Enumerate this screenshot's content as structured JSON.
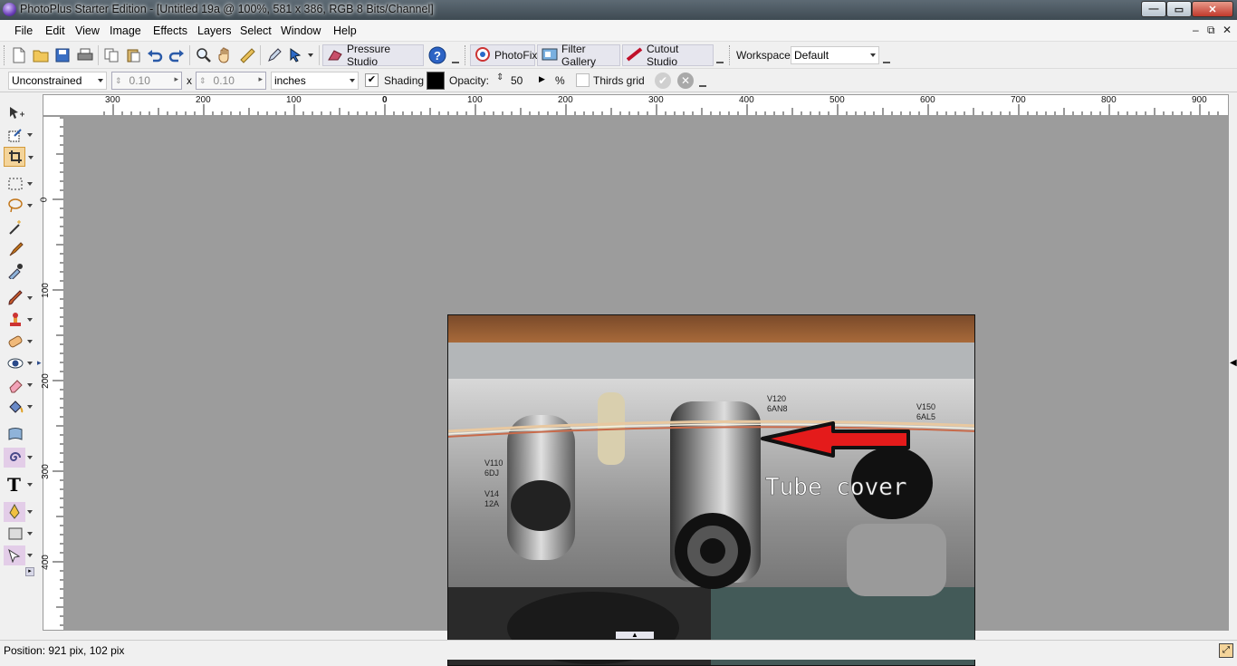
{
  "window": {
    "title": "PhotoPlus Starter Edition - [Untitled 19a @ 100%, 581 x 386, RGB 8 Bits/Channel]",
    "minimize": "—",
    "maximize": "▭",
    "close": "✕"
  },
  "menu": [
    "File",
    "Edit",
    "View",
    "Image",
    "Effects",
    "Layers",
    "Select",
    "Window",
    "Help"
  ],
  "mdi_controls": [
    "–",
    "⧉",
    "✕"
  ],
  "toolbar": {
    "pressure_studio": "Pressure Studio",
    "photofix": "PhotoFix",
    "filter_gallery": "Filter Gallery",
    "cutout_studio": "Cutout Studio",
    "workspace_label": "Workspace",
    "workspace_value": "Default"
  },
  "context_bar": {
    "mode": "Unconstrained",
    "width": "0.10",
    "x_label": "x",
    "height": "0.10",
    "units": "inches",
    "shading_label": "Shading",
    "shading_checked": true,
    "shading_color": "#000000",
    "opacity_label": "Opacity:",
    "opacity_value": "50",
    "opacity_unit": "%",
    "thirds_grid_label": "Thirds grid",
    "thirds_grid_checked": false
  },
  "ruler": {
    "top_labels": [
      "300",
      "200",
      "100",
      "0",
      "100",
      "200",
      "300",
      "400",
      "500",
      "600",
      "700",
      "800",
      "900"
    ],
    "left_labels": [
      "0",
      "100",
      "200",
      "300",
      "400"
    ]
  },
  "image": {
    "annotation_text": "Tube cover",
    "label_v120": "V120",
    "label_6an8": "6AN8",
    "label_v150": "V150",
    "label_6al5": "6AL5",
    "label_v110": "V110",
    "label_6d": "6DJ",
    "label_v14": "V14",
    "label_12a": "12A"
  },
  "status": {
    "position": "Position: 921 pix, 102 pix"
  },
  "colors": {
    "workspace_bg": "#9c9c9c",
    "arrow": "#e41b1b",
    "titlebar": "#4a5660"
  }
}
